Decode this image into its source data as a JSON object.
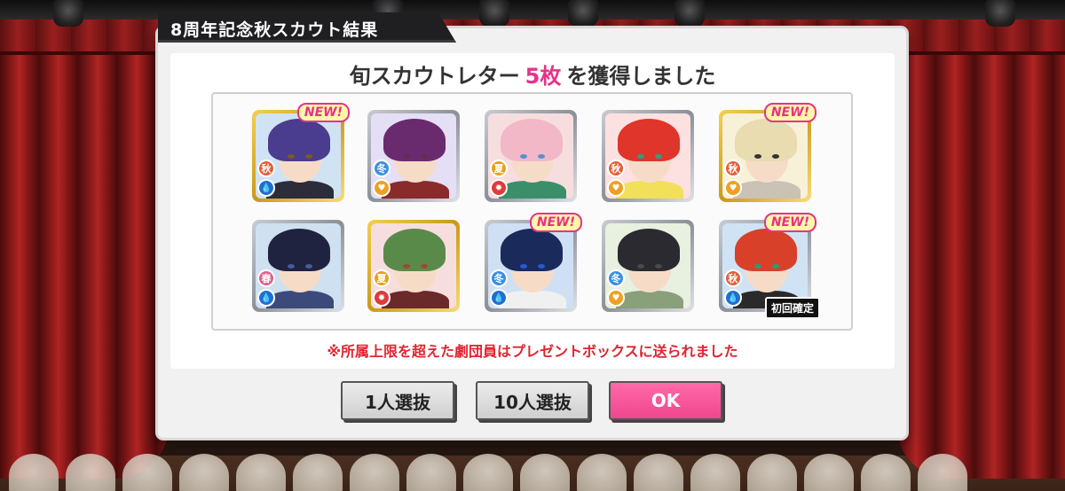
{
  "dialog": {
    "title": "8周年記念秋スカウト結果",
    "headline_prefix": "旬スカウトレター",
    "headline_count": "5枚",
    "headline_suffix": "を獲得しました",
    "notice": "※所属上限を超えた劇団員はプレゼントボックスに送られました"
  },
  "buttons": {
    "scout1": "1人選抜",
    "scout10": "10人選抜",
    "ok": "OK"
  },
  "badges": {
    "new": "NEW!",
    "first_guaranteed": "初回確定"
  },
  "cards": [
    {
      "rarity": "gold",
      "season": "秋",
      "season_color": "#e0603a",
      "attr": "drop",
      "attr_color": "#1e6fd0",
      "new": true,
      "hair": "#4a3c8f",
      "bg": "#cfe3f5",
      "body": "#2c2c3a",
      "eye": "#7a5a20"
    },
    {
      "rarity": "silver",
      "season": "冬",
      "season_color": "#3a8fe0",
      "attr": "heart",
      "attr_color": "#f0a020",
      "new": false,
      "hair": "#6a2a6e",
      "bg": "#e5dff5",
      "body": "#8a2a2a",
      "eye": "#6a2a4a"
    },
    {
      "rarity": "silver",
      "season": "夏",
      "season_color": "#e8a020",
      "attr": "star",
      "attr_color": "#e03a3a",
      "new": false,
      "hair": "#f2b8c8",
      "bg": "#f7dede",
      "body": "#3a8f6a",
      "eye": "#5a8fd0"
    },
    {
      "rarity": "silver",
      "season": "秋",
      "season_color": "#e0603a",
      "attr": "heart",
      "attr_color": "#f0a020",
      "new": false,
      "hair": "#e0352a",
      "bg": "#fde0e0",
      "body": "#f2e05a",
      "eye": "#2a9f8a"
    },
    {
      "rarity": "gold",
      "season": "秋",
      "season_color": "#e0603a",
      "attr": "heart",
      "attr_color": "#f0a020",
      "new": true,
      "hair": "#e8dcb0",
      "bg": "#f7f1d8",
      "body": "#c9c2b5",
      "eye": "#333333"
    },
    {
      "rarity": "silver",
      "season": "春",
      "season_color": "#e0608a",
      "attr": "drop",
      "attr_color": "#1e6fd0",
      "new": false,
      "hair": "#1f2340",
      "bg": "#cfe0f0",
      "body": "#3b4a7a",
      "eye": "#4a5a9a"
    },
    {
      "rarity": "gold",
      "season": "夏",
      "season_color": "#e8a020",
      "attr": "star",
      "attr_color": "#e03a3a",
      "new": false,
      "hair": "#5a8a4a",
      "bg": "#f7dede",
      "body": "#6a2a2a",
      "eye": "#a04a2a"
    },
    {
      "rarity": "silver",
      "season": "冬",
      "season_color": "#3a8fe0",
      "attr": "drop",
      "attr_color": "#1e6fd0",
      "new": true,
      "hair": "#1a2a5a",
      "bg": "#cfe0f5",
      "body": "#f0f0f0",
      "eye": "#2a5ad0"
    },
    {
      "rarity": "silver",
      "season": "冬",
      "season_color": "#3a8fe0",
      "attr": "heart",
      "attr_color": "#f0a020",
      "new": false,
      "hair": "#2a2a30",
      "bg": "#e8f0e0",
      "body": "#8aa07a",
      "eye": "#4a4a4a"
    },
    {
      "rarity": "silver",
      "season": "秋",
      "season_color": "#e0603a",
      "attr": "drop",
      "attr_color": "#1e6fd0",
      "new": true,
      "first": true,
      "hair": "#d8402a",
      "bg": "#cfe3f5",
      "body": "#2a2a2a",
      "eye": "#2a9f6a"
    }
  ],
  "colors": {
    "accent_pink": "#e8318a",
    "notice_red": "#e0242f"
  }
}
